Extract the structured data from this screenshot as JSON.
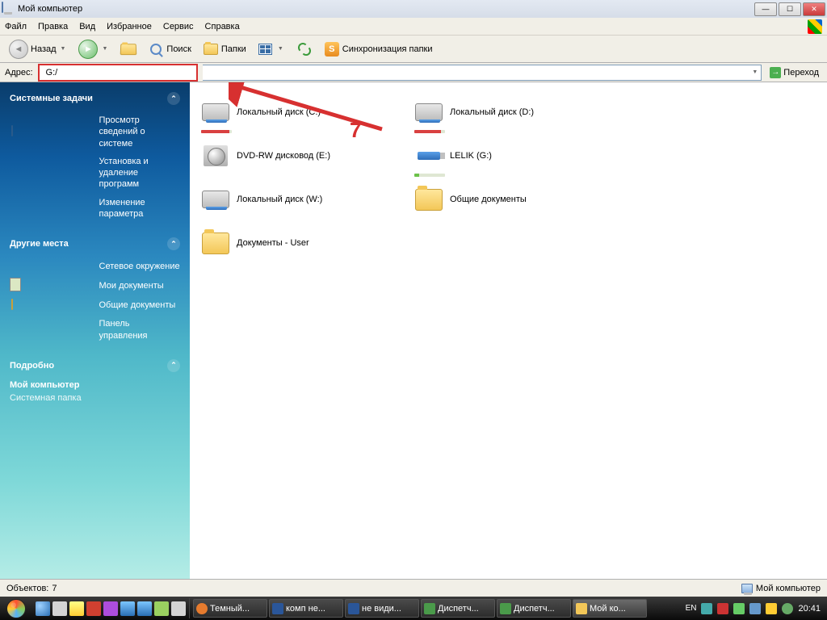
{
  "window": {
    "title": "Мой компьютер"
  },
  "menu": {
    "file": "Файл",
    "edit": "Правка",
    "view": "Вид",
    "favorites": "Избранное",
    "tools": "Сервис",
    "help": "Справка"
  },
  "toolbar": {
    "back": "Назад",
    "search": "Поиск",
    "folders": "Папки",
    "sync": "Синхронизация папки"
  },
  "addressbar": {
    "label": "Адрес:",
    "value": "G:/",
    "go": "Переход"
  },
  "annotation": {
    "number": "7"
  },
  "sidebar": {
    "tasks": {
      "title": "Системные задачи",
      "items": [
        "Просмотр сведений о системе",
        "Установка и удаление программ",
        "Изменение параметра"
      ]
    },
    "places": {
      "title": "Другие места",
      "items": [
        "Сетевое окружение",
        "Мои документы",
        "Общие документы",
        "Панель управления"
      ]
    },
    "details": {
      "title": "Подробно",
      "name": "Мой компьютер",
      "type": "Системная папка"
    }
  },
  "drives": [
    {
      "label": "Локальный диск (C:)",
      "icon": "drive",
      "usage": 92,
      "color": "red"
    },
    {
      "label": "Локальный диск (D:)",
      "icon": "drive",
      "usage": 88,
      "color": "red"
    },
    {
      "label": "DVD-RW дисковод (E:)",
      "icon": "dvd"
    },
    {
      "label": "LELIK (G:)",
      "icon": "usb",
      "usage": 15,
      "color": "green"
    },
    {
      "label": "Локальный диск (W:)",
      "icon": "drive"
    },
    {
      "label": "Общие документы",
      "icon": "folder"
    },
    {
      "label": "Документы - User",
      "icon": "folder"
    }
  ],
  "statusbar": {
    "objects_label": "Объектов:",
    "objects_count": "7",
    "location": "Мой компьютер"
  },
  "taskbar": {
    "tasks": [
      {
        "label": "Темный...",
        "icon": "ff"
      },
      {
        "label": "комп не...",
        "icon": "word"
      },
      {
        "label": "не види...",
        "icon": "word"
      },
      {
        "label": "Диспетч...",
        "icon": "sys"
      },
      {
        "label": "Диспетч...",
        "icon": "sys"
      },
      {
        "label": "Мой ко...",
        "icon": "fold",
        "active": true
      }
    ],
    "lang": "EN",
    "clock": "20:41"
  }
}
